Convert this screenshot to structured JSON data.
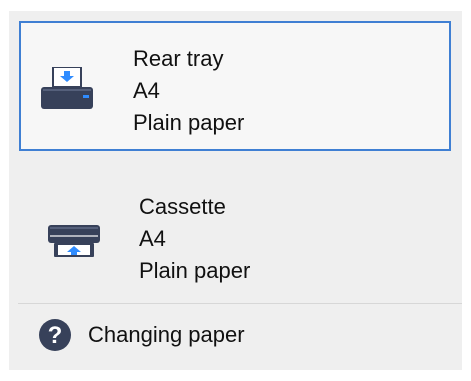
{
  "options": [
    {
      "source": "Rear tray",
      "size": "A4",
      "type": "Plain paper",
      "icon": "rear-tray-printer-icon"
    },
    {
      "source": "Cassette",
      "size": "A4",
      "type": "Plain paper",
      "icon": "cassette-printer-icon"
    }
  ],
  "help": {
    "label": "Changing paper",
    "icon": "question-icon"
  },
  "colors": {
    "accent": "#3f7fd3",
    "panel": "#efefef",
    "icon": "#37415a",
    "arrow": "#2f8cff"
  }
}
